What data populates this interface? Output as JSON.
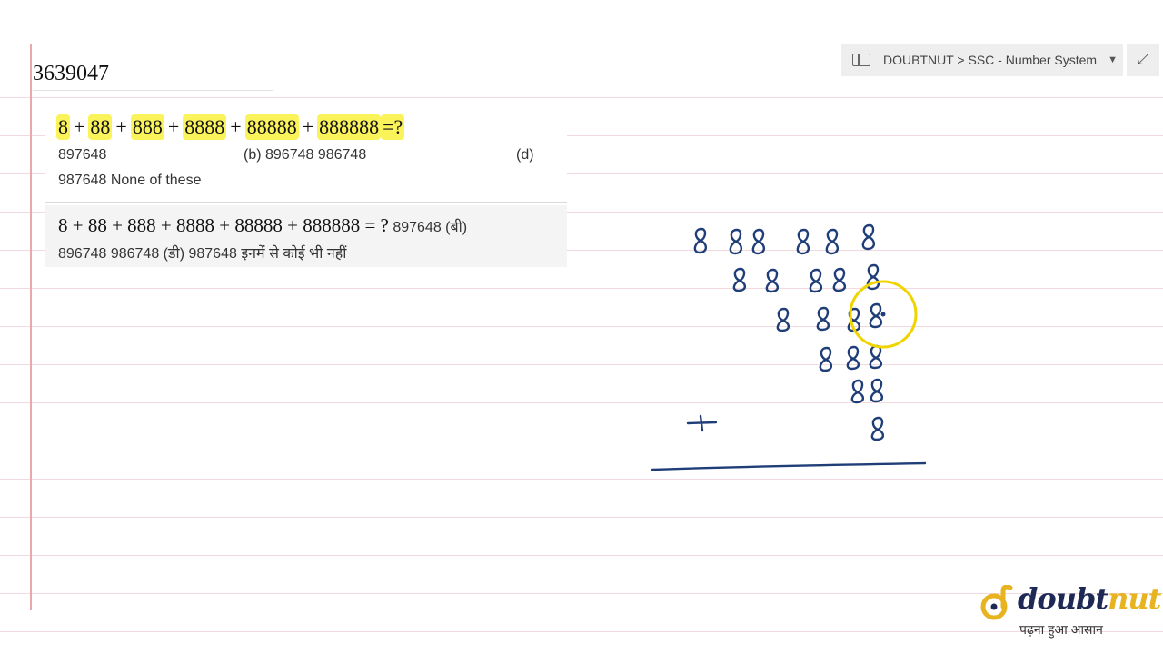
{
  "video_id": "3639047",
  "breadcrumb": {
    "text": "DOUBTNUT > SSC - Number System"
  },
  "question": {
    "terms": [
      "8",
      "88",
      "888",
      "8888",
      "88888",
      "888888"
    ],
    "plus": "+",
    "tail": "=?",
    "opt_a": "897648",
    "opt_b": "(b)  896748 986748",
    "opt_d": "(d)",
    "opt_d_line": "987648 None of these"
  },
  "hindi": {
    "equation": "8 + 88 + 888 + 8888 + 88888 + 888888 = ?",
    "line1_rest": " 897648 (बी)",
    "line2": "896748 986748 (डी) 987648 इनमें से कोई भी नहीं"
  },
  "logo": {
    "word_main": "doubt",
    "word_accent": "nut",
    "tagline": "पढ़ना हुआ आसान"
  },
  "colors": {
    "highlight": "#fbf35a",
    "pen": "#1f3e78",
    "cursor": "#f0d400",
    "margin": "#e9a7ae",
    "brand_dark": "#1e2a55",
    "brand_accent": "#e8b320"
  },
  "icons": {
    "breadcrumb": "panel-icon",
    "dropdown": "caret-down-icon",
    "expand": "expand-icon"
  }
}
